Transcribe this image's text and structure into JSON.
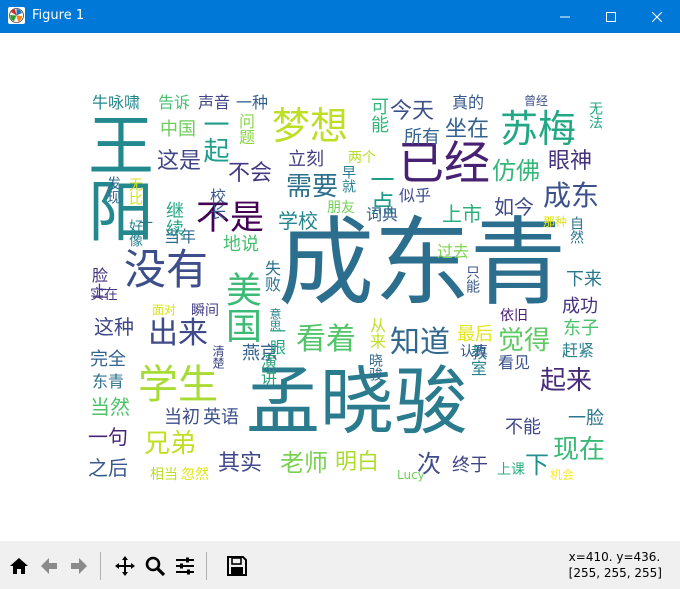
{
  "window": {
    "title": "Figure 1",
    "titlebar_color": "#0078d7",
    "controls": [
      "minimize-icon",
      "maximize-icon",
      "close-icon"
    ]
  },
  "wordcloud": {
    "words": [
      {
        "text": "成东青",
        "color": "#2c6e8e"
      },
      {
        "text": "孟晓骏",
        "color": "#2a7b8e"
      },
      {
        "text": "王阳",
        "color": "#23898e"
      },
      {
        "text": "已经",
        "color": "#482173"
      },
      {
        "text": "没有",
        "color": "#3d4e8a"
      },
      {
        "text": "学生",
        "color": "#a8db34"
      },
      {
        "text": "苏梅",
        "color": "#22a884"
      },
      {
        "text": "梦想",
        "color": "#bddf26"
      },
      {
        "text": "美国",
        "color": "#3bbb75"
      },
      {
        "text": "不是",
        "color": "#440154"
      },
      {
        "text": "看着",
        "color": "#52c569"
      },
      {
        "text": "知道",
        "color": "#31688e"
      },
      {
        "text": "出来",
        "color": "#3e4a89"
      },
      {
        "text": "成东",
        "color": "#3b528b"
      },
      {
        "text": "需要",
        "color": "#2d708e"
      },
      {
        "text": "一起",
        "color": "#1f9e89"
      },
      {
        "text": "觉得",
        "color": "#5ec962"
      },
      {
        "text": "起来",
        "color": "#472c7a"
      },
      {
        "text": "现在",
        "color": "#3aba76"
      },
      {
        "text": "兄弟",
        "color": "#c2df23"
      },
      {
        "text": "老师",
        "color": "#7ad151"
      },
      {
        "text": "其实",
        "color": "#3f4788"
      },
      {
        "text": "明白",
        "color": "#addc30"
      },
      {
        "text": "仿佛",
        "color": "#35b779"
      },
      {
        "text": "眼神",
        "color": "#46337e"
      },
      {
        "text": "一点",
        "color": "#1e9c89"
      },
      {
        "text": "今天",
        "color": "#3c508b"
      },
      {
        "text": "坐在",
        "color": "#34618d"
      },
      {
        "text": "这是",
        "color": "#404588"
      },
      {
        "text": "不会",
        "color": "#443983"
      },
      {
        "text": "学校",
        "color": "#24878e"
      },
      {
        "text": "上市",
        "color": "#2ab07f"
      },
      {
        "text": "如今",
        "color": "#3f4889"
      },
      {
        "text": "继续",
        "color": "#22a785"
      },
      {
        "text": "校长",
        "color": "#38588c"
      },
      {
        "text": "可能",
        "color": "#31b57b"
      },
      {
        "text": "所有",
        "color": "#33638d"
      },
      {
        "text": "中国",
        "color": "#6ccd5a"
      },
      {
        "text": "告诉",
        "color": "#45be71"
      },
      {
        "text": "声音",
        "color": "#414487"
      },
      {
        "text": "一种",
        "color": "#34608d"
      },
      {
        "text": "真的",
        "color": "#38598c"
      },
      {
        "text": "曾经",
        "color": "#3b528b"
      },
      {
        "text": "无法",
        "color": "#20a486"
      },
      {
        "text": "牛咏啸",
        "color": "#23888e"
      },
      {
        "text": "问题",
        "color": "#8bd646"
      },
      {
        "text": "立刻",
        "color": "#433e85"
      },
      {
        "text": "两个",
        "color": "#b5de2b"
      },
      {
        "text": "早就",
        "color": "#26818e"
      },
      {
        "text": "朋友",
        "color": "#73d056"
      },
      {
        "text": "词典",
        "color": "#355f8d"
      },
      {
        "text": "似乎",
        "color": "#3e4c8a"
      },
      {
        "text": "那种",
        "color": "#dde318"
      },
      {
        "text": "自然",
        "color": "#2c738e"
      },
      {
        "text": "下来",
        "color": "#2a778e"
      },
      {
        "text": "成功",
        "color": "#46307e"
      },
      {
        "text": "东子",
        "color": "#4ac16d"
      },
      {
        "text": "赶紧",
        "color": "#277f8e"
      },
      {
        "text": "看见",
        "color": "#3b518b"
      },
      {
        "text": "教室",
        "color": "#25838e"
      },
      {
        "text": "不能",
        "color": "#3f4788"
      },
      {
        "text": "一脸",
        "color": "#2b758e"
      },
      {
        "text": "过去",
        "color": "#7fd34e"
      },
      {
        "text": "只能",
        "color": "#37598c"
      },
      {
        "text": "依旧",
        "color": "#481f70"
      },
      {
        "text": "最后",
        "color": "#e5e419"
      },
      {
        "text": "认真",
        "color": "#3a548c"
      },
      {
        "text": "从来",
        "color": "#c0df25"
      },
      {
        "text": "晓骏",
        "color": "#31678e"
      },
      {
        "text": "终于",
        "color": "#414487"
      },
      {
        "text": "上课",
        "color": "#29af7f"
      },
      {
        "text": "下",
        "color": "#218f8d"
      },
      {
        "text": "次",
        "color": "#3e4a89"
      },
      {
        "text": "机会",
        "color": "#fde725"
      },
      {
        "text": "Lucy",
        "color": "#6ece58"
      },
      {
        "text": "当初",
        "color": "#3d4e8a"
      },
      {
        "text": "英语",
        "color": "#3b528b"
      },
      {
        "text": "相当",
        "color": "#bade28"
      },
      {
        "text": "忽然",
        "color": "#e2e418"
      },
      {
        "text": "当然",
        "color": "#4ec36b"
      },
      {
        "text": "一句",
        "color": "#482475"
      },
      {
        "text": "之后",
        "color": "#38588c"
      },
      {
        "text": "东青",
        "color": "#2d718e"
      },
      {
        "text": "完全",
        "color": "#32648e"
      },
      {
        "text": "这种",
        "color": "#3e4989"
      },
      {
        "text": "演讲",
        "color": "#2ea37a"
      },
      {
        "text": "燕京",
        "color": "#34618d"
      },
      {
        "text": "清楚",
        "color": "#3f4788"
      },
      {
        "text": "面对",
        "color": "#d8e219"
      },
      {
        "text": "瞬间",
        "color": "#433d84"
      },
      {
        "text": "意思",
        "color": "#26828e"
      },
      {
        "text": "一眼",
        "color": "#22a785"
      },
      {
        "text": "实在",
        "color": "#443983"
      },
      {
        "text": "脸上",
        "color": "#46337f"
      },
      {
        "text": "当年",
        "color": "#2f6c8e"
      },
      {
        "text": "地说",
        "color": "#46c06f"
      },
      {
        "text": "失败",
        "color": "#2d718e"
      },
      {
        "text": "好像",
        "color": "#26828e"
      },
      {
        "text": "无比",
        "color": "#d2e21b"
      },
      {
        "text": "发现",
        "color": "#31678e"
      },
      {
        "text": "一",
        "color": "#2b758e"
      }
    ]
  },
  "toolbar": {
    "buttons": [
      {
        "name": "home-icon",
        "tooltip": "Home"
      },
      {
        "name": "back-icon",
        "tooltip": "Back"
      },
      {
        "name": "forward-icon",
        "tooltip": "Forward"
      },
      {
        "name": "pan-icon",
        "tooltip": "Pan"
      },
      {
        "name": "zoom-icon",
        "tooltip": "Zoom"
      },
      {
        "name": "configure-subplots-icon",
        "tooltip": "Subplots"
      },
      {
        "name": "save-icon",
        "tooltip": "Save"
      }
    ],
    "coords_line1": "x=410. y=436.",
    "coords_line2": "[255, 255, 255]"
  }
}
